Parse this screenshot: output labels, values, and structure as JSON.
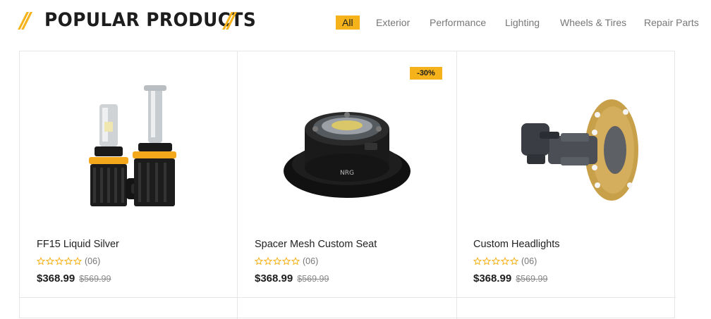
{
  "section": {
    "title": "POPULAR PRODUCTS",
    "slashes": "//"
  },
  "tabs": [
    {
      "label": "All",
      "active": true
    },
    {
      "label": "Exterior"
    },
    {
      "label": "Performance"
    },
    {
      "label": "Lighting"
    },
    {
      "label": "Wheels & Tires"
    },
    {
      "label": "Repair Parts"
    }
  ],
  "products": [
    {
      "name": "FF15 Liquid Silver",
      "rating_count": "(06)",
      "price": "$368.99",
      "old_price": "$569.99",
      "badge": "",
      "stars": 0,
      "icon": "headlight-bulb-icon"
    },
    {
      "name": "Spacer Mesh Custom Seat",
      "rating_count": "(06)",
      "price": "$368.99",
      "old_price": "$569.99",
      "badge": "-30%",
      "stars": 0,
      "icon": "quick-release-hub-icon"
    },
    {
      "name": "Custom Headlights",
      "rating_count": "(06)",
      "price": "$368.99",
      "old_price": "$569.99",
      "badge": "",
      "stars": 0,
      "icon": "steering-hub-adapter-icon"
    }
  ],
  "colors": {
    "accent": "#f5b21a",
    "text": "#1d1d1d",
    "muted": "#777777",
    "border": "#e6e6e6"
  }
}
